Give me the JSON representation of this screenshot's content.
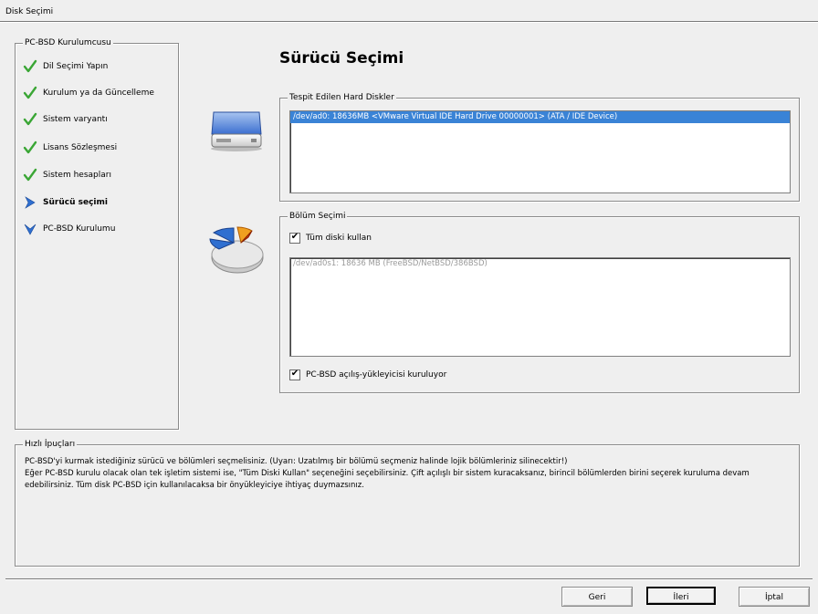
{
  "window": {
    "title": "Disk Seçimi"
  },
  "steps": {
    "legend": "PC-BSD Kurulumcusu",
    "items": [
      {
        "label": "Dil Seçimi Yapın",
        "state": "done"
      },
      {
        "label": "Kurulum ya da Güncelleme",
        "state": "done"
      },
      {
        "label": "Sistem varyantı",
        "state": "done"
      },
      {
        "label": "Lisans Sözleşmesi",
        "state": "done"
      },
      {
        "label": "Sistem hesapları",
        "state": "done"
      },
      {
        "label": "Sürücü seçimi",
        "state": "current"
      },
      {
        "label": "PC-BSD Kurulumu",
        "state": "pending"
      }
    ]
  },
  "page": {
    "title": "Sürücü Seçimi"
  },
  "disks": {
    "legend": "Tespit Edilen Hard Diskler",
    "items": [
      "/dev/ad0: 18636MB <VMware Virtual IDE Hard Drive 00000001> (ATA / IDE Device)"
    ],
    "selected_index": 0
  },
  "partitions": {
    "legend": "Bölüm Seçimi",
    "use_whole_disk_label": "Tüm diski kullan",
    "use_whole_disk_checked": true,
    "items": [
      "/dev/ad0s1: 18636 MB (FreeBSD/NetBSD/386BSD)"
    ],
    "bootloader_label": "PC-BSD açılış-yükleyicisi kuruluyor",
    "bootloader_checked": true
  },
  "tips": {
    "legend": "Hızlı İpuçları",
    "lines": [
      "PC-BSD'yi kurmak istediğiniz sürücü ve bölümleri seçmelisiniz. (Uyarı: Uzatılmış bir bölümü seçmeniz halinde lojik bölümleriniz silinecektir!)",
      "Eğer PC-BSD kurulu olacak olan tek işletim sistemi ise, \"Tüm Diski Kullan\" seçeneğini seçebilirsiniz. Çift açılışlı bir sistem kuracaksanız, birincil bölümlerden birini seçerek kuruluma devam",
      "edebilirsiniz. Tüm disk PC-BSD için kullanılacaksa bir önyükleyiciye ihtiyaç duymazsınız."
    ]
  },
  "buttons": {
    "back": "Geri",
    "next": "İleri",
    "cancel": "İptal"
  },
  "colors": {
    "selection": "#3a83d6",
    "check_green": "#3aa635",
    "arrow_blue": "#2f6fd0"
  },
  "icons": {
    "done": "green-check-icon",
    "current": "blue-arrow-icon",
    "pending": "blue-chevron-down-icon"
  }
}
